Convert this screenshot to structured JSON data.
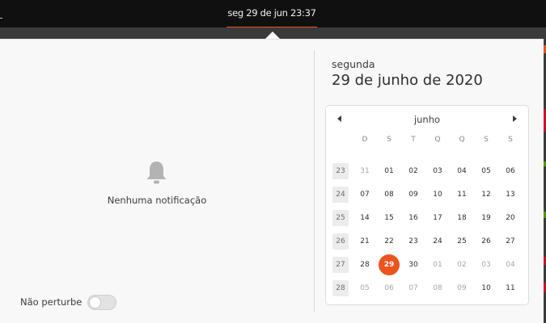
{
  "topbar": {
    "clock": "seg 29 de jun  23:37"
  },
  "notifications": {
    "empty_label": "Nenhuma notificação",
    "dnd_label": "Não perturbe",
    "dnd_enabled": false
  },
  "calendar": {
    "weekday": "segunda",
    "full_date": "29 de junho de 2020",
    "month_label": "junho",
    "day_headers": [
      "D",
      "S",
      "T",
      "Q",
      "Q",
      "S",
      "S"
    ],
    "weeks": [
      {
        "num": "23",
        "days": [
          "31",
          "01",
          "02",
          "03",
          "04",
          "05",
          "06"
        ]
      },
      {
        "num": "24",
        "days": [
          "07",
          "08",
          "09",
          "10",
          "11",
          "12",
          "13"
        ]
      },
      {
        "num": "25",
        "days": [
          "14",
          "15",
          "16",
          "17",
          "18",
          "19",
          "20"
        ]
      },
      {
        "num": "26",
        "days": [
          "21",
          "22",
          "23",
          "24",
          "25",
          "26",
          "27"
        ]
      },
      {
        "num": "27",
        "days": [
          "28",
          "29",
          "30",
          "01",
          "02",
          "03",
          "04"
        ]
      },
      {
        "num": "28",
        "days": [
          "05",
          "06",
          "07",
          "08",
          "09",
          "10",
          "11"
        ]
      }
    ],
    "accent_color": "#e95420"
  }
}
